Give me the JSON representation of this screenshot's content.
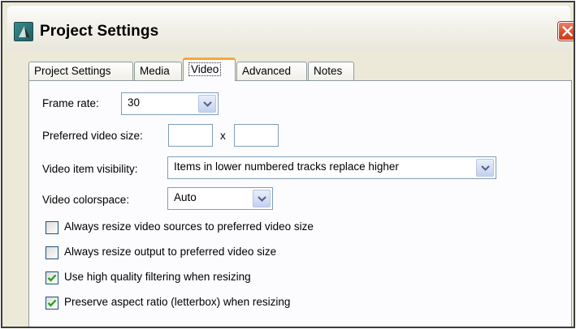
{
  "window": {
    "title": "Project Settings",
    "icons": {
      "app": "project-settings-app-icon",
      "close": "close-icon"
    }
  },
  "tabs": [
    {
      "label": "Project Settings",
      "active": false
    },
    {
      "label": "Media",
      "active": false
    },
    {
      "label": "Video",
      "active": true
    },
    {
      "label": "Advanced",
      "active": false
    },
    {
      "label": "Notes",
      "active": false
    }
  ],
  "video": {
    "frame_rate": {
      "label": "Frame rate:",
      "value": "30"
    },
    "preferred_size": {
      "label": "Preferred video size:",
      "width": "",
      "separator": "x",
      "height": ""
    },
    "item_visibility": {
      "label": "Video item visibility:",
      "value": "Items in lower numbered tracks replace higher"
    },
    "colorspace": {
      "label": "Video colorspace:",
      "value": "Auto"
    },
    "checkboxes": [
      {
        "label": "Always resize video sources to preferred video size",
        "checked": false
      },
      {
        "label": "Always resize output to preferred video size",
        "checked": false
      },
      {
        "label": "Use high quality filtering when resizing",
        "checked": true
      },
      {
        "label": "Preserve aspect ratio (letterbox) when resizing",
        "checked": true
      }
    ]
  },
  "colors": {
    "active_tab_accent": "#f7a63b",
    "close_button": "#d9502d",
    "checkmark": "#21a121"
  }
}
